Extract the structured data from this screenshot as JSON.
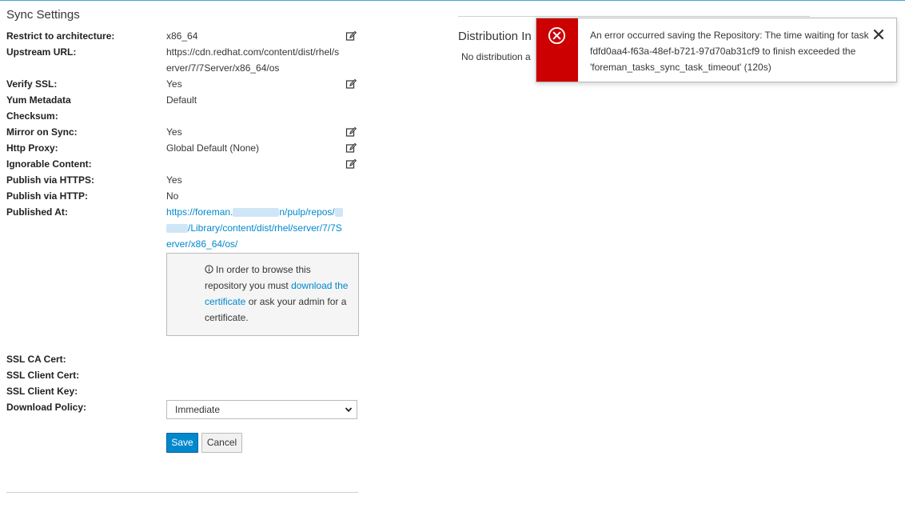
{
  "sync": {
    "title": "Sync Settings",
    "restrict_label": "Restrict to architecture:",
    "restrict_value": "x86_64",
    "upstream_label": "Upstream URL:",
    "upstream_line1": "https://cdn.redhat.com/content/dist/rhel/s",
    "upstream_line2": "erver/7/7Server/x86_64/os",
    "verify_label": "Verify SSL:",
    "verify_value": "Yes",
    "yum_label_line1": "Yum Metadata",
    "yum_label_line2": "Checksum:",
    "yum_value": "Default",
    "mirror_label": "Mirror on Sync:",
    "mirror_value": "Yes",
    "proxy_label": "Http Proxy:",
    "proxy_value": "Global Default (None)",
    "ignorable_label": "Ignorable Content:",
    "https_label": "Publish via HTTPS:",
    "https_value": "Yes",
    "http_label": "Publish via HTTP:",
    "http_value": "No",
    "published_label": "Published At:",
    "published_part1": "https://foreman.",
    "published_part2": "n/pulp/repos/",
    "published_line2": "/Library/content/dist/rhel/server/7/7S",
    "published_line3": "erver/x86_64/os/",
    "cert_text_before": "In order to browse this repository you must",
    "cert_link": "download the certificate",
    "cert_text_after": "or ask your admin for a certificate.",
    "ssl_ca_label": "SSL CA Cert:",
    "ssl_client_cert_label": "SSL Client Cert:",
    "ssl_client_key_label": "SSL Client Key:",
    "download_label": "Download Policy:",
    "download_value": "Immediate",
    "save_label": "Save",
    "cancel_label": "Cancel"
  },
  "distribution": {
    "title": "Distribution In",
    "text": "No distribution a"
  },
  "toast": {
    "message": "An error occurred saving the Repository: The time waiting for task fdfd0aa4-f63a-48ef-b721-97d70ab31cf9 to finish exceeded the 'foreman_tasks_sync_task_timeout' (120s)"
  },
  "colors": {
    "error_red": "#cc0000",
    "link_blue": "#0088ce",
    "primary_button": "#0088ce"
  },
  "icons": {
    "edit": "edit-icon",
    "info": "info-circle-icon",
    "error": "error-circle-icon",
    "close": "close-icon",
    "caret": "chevron-down-icon"
  }
}
